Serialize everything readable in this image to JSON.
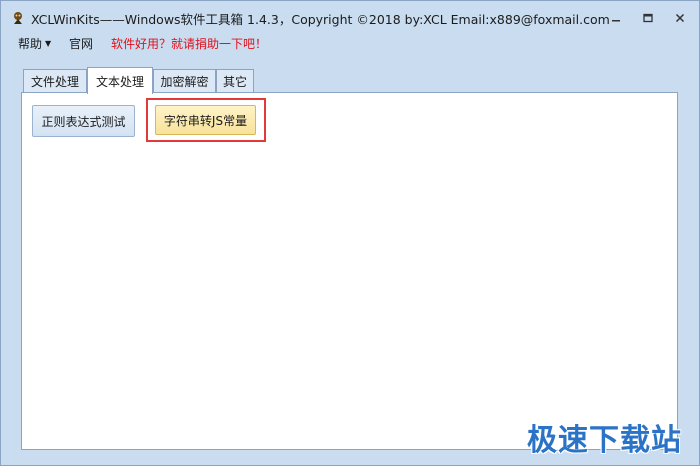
{
  "window": {
    "title": "XCLWinKits——Windows软件工具箱   1.4.3，Copyright ©2018 by:XCL Email:x889@foxmail.com",
    "minimize_icon": "minimize-icon",
    "maximize_icon": "maximize-icon",
    "close_icon": "close-icon"
  },
  "menu": {
    "help": "帮助",
    "website": "官网",
    "promo": "软件好用？就请捐助一下吧！"
  },
  "tabs": [
    {
      "label": "文件处理",
      "active": false
    },
    {
      "label": "文本处理",
      "active": true
    },
    {
      "label": "加密解密",
      "active": false
    },
    {
      "label": "其它",
      "active": false
    }
  ],
  "panel": {
    "buttons": [
      {
        "label": "正则表达式测试"
      },
      {
        "label": "字符串转JS常量",
        "highlighted": true
      }
    ]
  },
  "watermark": "极速下载站",
  "colors": {
    "chrome": "#c9dcf0",
    "highlight_border": "#e23a3a",
    "promo_text": "#e0121b",
    "watermark": "#2b73c6"
  }
}
